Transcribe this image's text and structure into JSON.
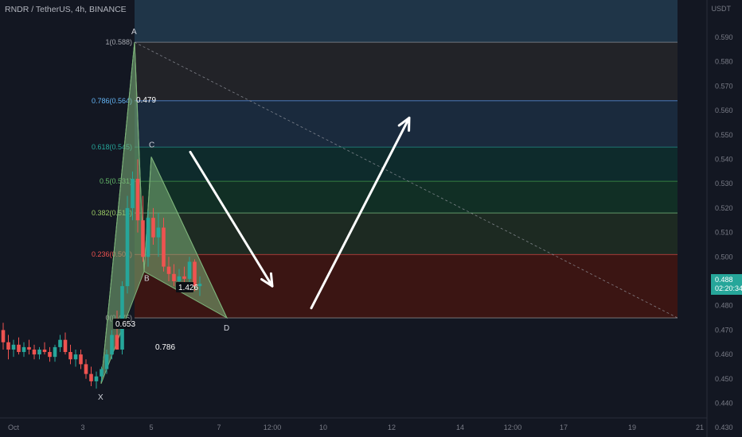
{
  "header": {
    "symbol": "RNDR / TetherUS, 4h, BINANCE"
  },
  "price_axis": {
    "currency": "USDT",
    "ticks": [
      "0.590",
      "0.580",
      "0.570",
      "0.560",
      "0.550",
      "0.540",
      "0.530",
      "0.520",
      "0.510",
      "0.500",
      "0.490",
      "0.480",
      "0.470",
      "0.460",
      "0.450",
      "0.440",
      "0.430"
    ]
  },
  "time_axis": {
    "ticks": [
      "Oct",
      "3",
      "5",
      "7",
      "12:00",
      "10",
      "12",
      "14",
      "12:00",
      "17",
      "19",
      "21"
    ]
  },
  "current_price": {
    "price": "0.488",
    "countdown": "02:20:34",
    "color": "#26a69a"
  },
  "colors": {
    "up": "#26a69a",
    "down": "#ef5350",
    "fib_top": "#1f3548",
    "fib_786": "#1c2a3c",
    "fib_618": "#162a30",
    "fib_5": "#0f3028",
    "fib_382": "#1e2b22",
    "fib_236": "#3c1614",
    "pattern": "#7db37a"
  },
  "chart_data": {
    "type": "candlestick",
    "symbol": "RNDR / TetherUS",
    "interval": "4h",
    "exchange": "BINANCE",
    "ylim": [
      0.43,
      0.595
    ],
    "fibonacci": [
      {
        "label": "1(0.588)",
        "level": 1,
        "price": 0.588
      },
      {
        "label": "0.786(0.564)",
        "level": 0.786,
        "price": 0.564
      },
      {
        "label": "0.618(0.545)",
        "level": 0.618,
        "price": 0.545
      },
      {
        "label": "0.5(0.531)",
        "level": 0.5,
        "price": 0.531
      },
      {
        "label": "0.382(0.518)",
        "level": 0.382,
        "price": 0.518
      },
      {
        "label": "0.236(0.501)",
        "level": 0.236,
        "price": 0.501
      },
      {
        "label": "0(0.475)",
        "level": 0,
        "price": 0.475
      }
    ],
    "harmonic_points": {
      "X": 0.448,
      "A": 0.588,
      "B": 0.494,
      "C": 0.541,
      "D": 0.475
    },
    "harmonic_ratios": [
      "0.479",
      "1.426",
      "0.653",
      "0.786"
    ],
    "projection_arrows": [
      {
        "direction": "down",
        "from": 0.543,
        "to": 0.488
      },
      {
        "direction": "up",
        "from": 0.479,
        "to": 0.557
      }
    ],
    "candles": [
      [
        0.47,
        0.473,
        0.462,
        0.465
      ],
      [
        0.465,
        0.468,
        0.458,
        0.462
      ],
      [
        0.462,
        0.466,
        0.459,
        0.464
      ],
      [
        0.464,
        0.467,
        0.46,
        0.461
      ],
      [
        0.461,
        0.465,
        0.459,
        0.463
      ],
      [
        0.463,
        0.466,
        0.46,
        0.462
      ],
      [
        0.462,
        0.464,
        0.458,
        0.46
      ],
      [
        0.46,
        0.463,
        0.458,
        0.462
      ],
      [
        0.462,
        0.465,
        0.46,
        0.461
      ],
      [
        0.461,
        0.463,
        0.457,
        0.459
      ],
      [
        0.459,
        0.464,
        0.457,
        0.463
      ],
      [
        0.463,
        0.468,
        0.461,
        0.466
      ],
      [
        0.466,
        0.469,
        0.46,
        0.461
      ],
      [
        0.461,
        0.464,
        0.456,
        0.458
      ],
      [
        0.458,
        0.462,
        0.455,
        0.46
      ],
      [
        0.46,
        0.462,
        0.454,
        0.456
      ],
      [
        0.456,
        0.458,
        0.45,
        0.452
      ],
      [
        0.452,
        0.455,
        0.447,
        0.449
      ],
      [
        0.449,
        0.453,
        0.446,
        0.451
      ],
      [
        0.451,
        0.455,
        0.449,
        0.454
      ],
      [
        0.454,
        0.462,
        0.452,
        0.46
      ],
      [
        0.46,
        0.47,
        0.458,
        0.468
      ],
      [
        0.468,
        0.478,
        0.464,
        0.462
      ],
      [
        0.462,
        0.49,
        0.46,
        0.488
      ],
      [
        0.488,
        0.525,
        0.485,
        0.52
      ],
      [
        0.52,
        0.535,
        0.515,
        0.532
      ],
      [
        0.532,
        0.54,
        0.51,
        0.515
      ],
      [
        0.515,
        0.525,
        0.498,
        0.5
      ],
      [
        0.5,
        0.519,
        0.496,
        0.516
      ],
      [
        0.516,
        0.52,
        0.505,
        0.508
      ],
      [
        0.508,
        0.518,
        0.5,
        0.512
      ],
      [
        0.512,
        0.516,
        0.494,
        0.496
      ],
      [
        0.496,
        0.5,
        0.49,
        0.493
      ],
      [
        0.493,
        0.497,
        0.488,
        0.49
      ],
      [
        0.49,
        0.495,
        0.487,
        0.492
      ],
      [
        0.492,
        0.496,
        0.488,
        0.491
      ],
      [
        0.491,
        0.5,
        0.489,
        0.498
      ],
      [
        0.498,
        0.499,
        0.486,
        0.488
      ],
      [
        0.488,
        0.492,
        0.484,
        0.489
      ]
    ]
  }
}
